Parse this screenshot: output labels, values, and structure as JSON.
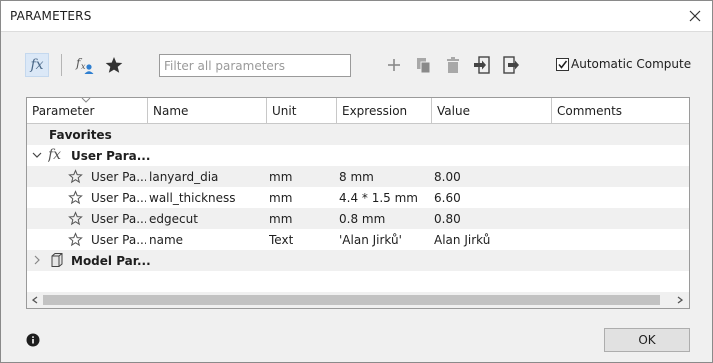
{
  "window": {
    "title": "PARAMETERS"
  },
  "toolbar": {
    "icons": [
      "fx-icon",
      "user-parameter-icon",
      "star-icon",
      "add-icon",
      "copy-icon",
      "delete-icon",
      "import-icon",
      "export-icon"
    ],
    "fx_label": "fx",
    "filter_placeholder": "Filter all parameters",
    "auto_compute_label": "Automatic Compute",
    "auto_compute_checked": true
  },
  "table": {
    "columns": [
      "Parameter",
      "Name",
      "Unit",
      "Expression",
      "Value",
      "Comments"
    ],
    "favorites_label": "Favorites",
    "user_group_label": "User Para...",
    "user_rows": [
      {
        "parameter": "User Pa...",
        "name": "lanyard_dia",
        "unit": "mm",
        "expression": "8 mm",
        "value": "8.00",
        "comments": ""
      },
      {
        "parameter": "User Pa...",
        "name": "wall_thickness",
        "unit": "mm",
        "expression": "4.4 * 1.5 mm",
        "value": "6.60",
        "comments": ""
      },
      {
        "parameter": "User Pa...",
        "name": "edgecut",
        "unit": "mm",
        "expression": "0.8 mm",
        "value": "0.80",
        "comments": ""
      },
      {
        "parameter": "User Pa...",
        "name": "name",
        "unit": "Text",
        "expression": "'Alan Jirků'",
        "value": "Alan Jirků",
        "comments": ""
      }
    ],
    "model_group_label": "Model Par..."
  },
  "footer": {
    "ok_label": "OK"
  },
  "colors": {
    "fx_active_bg": "#dbe8f7",
    "row_alt": "#f0f0f0",
    "dialog_bg": "#f0f0f0"
  }
}
